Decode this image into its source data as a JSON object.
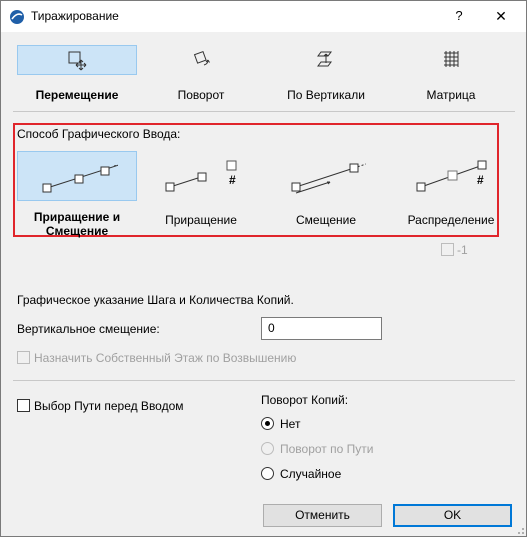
{
  "window": {
    "title": "Тиражирование",
    "help": "?",
    "close": "✕"
  },
  "modes": [
    {
      "label": "Перемещение",
      "icon": "move-icon",
      "selected": true
    },
    {
      "label": "Поворот",
      "icon": "rotate-icon",
      "selected": false
    },
    {
      "label": "По Вертикали",
      "icon": "elevate-icon",
      "selected": false
    },
    {
      "label": "Матрица",
      "icon": "matrix-icon",
      "selected": false
    }
  ],
  "input_method": {
    "heading": "Способ Графического Ввода:",
    "options": [
      {
        "label_line1": "Приращение и",
        "label_line2": "Смещение",
        "selected": true
      },
      {
        "label_line1": "Приращение",
        "label_line2": "",
        "selected": false
      },
      {
        "label_line1": "Смещение",
        "label_line2": "",
        "selected": false
      },
      {
        "label_line1": "Распределение",
        "label_line2": "",
        "selected": false
      }
    ],
    "hash": "#",
    "minus_one_label": "-1"
  },
  "info_text": "Графическое указание Шага и Количества Копий.",
  "vertical_offset": {
    "label": "Вертикальное смещение:",
    "value": "0"
  },
  "assign_story": {
    "label": "Назначить Собственный Этаж по Возвышению",
    "checked": false,
    "disabled": true
  },
  "path_select": {
    "label": "Выбор Пути перед Вводом",
    "checked": false
  },
  "copy_rotation": {
    "heading": "Поворот Копий:",
    "options": [
      {
        "label": "Нет",
        "checked": true,
        "disabled": false
      },
      {
        "label": "Поворот по Пути",
        "checked": false,
        "disabled": true
      },
      {
        "label": "Случайное",
        "checked": false,
        "disabled": false
      }
    ]
  },
  "buttons": {
    "cancel": "Отменить",
    "ok": "OK"
  },
  "colors": {
    "selection": "#cce4f7",
    "highlight_border": "#e0252b",
    "default_button": "#0078d7"
  }
}
